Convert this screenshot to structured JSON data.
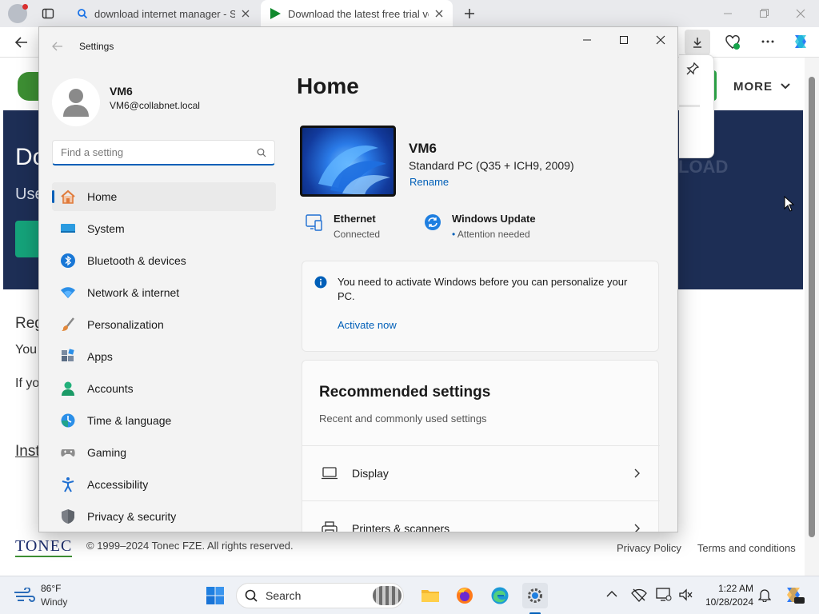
{
  "browser": {
    "tabs": [
      {
        "label": "download internet manager - Sea"
      },
      {
        "label": "Download the latest free trial vers"
      }
    ]
  },
  "webpage": {
    "hero_heading": "Do",
    "hero_sub": "Use",
    "hero_right": "LOAD",
    "more_label": "MORE",
    "reg_heading": "Reg",
    "reg_line1": "You",
    "reg_line2": "If yo",
    "inst_heading": "Inst",
    "logo": "TONEC",
    "copyright": "© 1999–2024 Tonec FZE. All rights reserved.",
    "footer_links": [
      "Privacy Policy",
      "Terms and conditions"
    ]
  },
  "settings": {
    "window_title": "Settings",
    "user": {
      "name": "VM6",
      "email": "VM6@collabnet.local"
    },
    "search_placeholder": "Find a setting",
    "nav": [
      {
        "label": "Home",
        "icon": "home-icon",
        "active": true
      },
      {
        "label": "System",
        "icon": "system-icon"
      },
      {
        "label": "Bluetooth & devices",
        "icon": "bluetooth-icon"
      },
      {
        "label": "Network & internet",
        "icon": "network-icon"
      },
      {
        "label": "Personalization",
        "icon": "brush-icon"
      },
      {
        "label": "Apps",
        "icon": "apps-icon"
      },
      {
        "label": "Accounts",
        "icon": "accounts-icon"
      },
      {
        "label": "Time & language",
        "icon": "time-language-icon"
      },
      {
        "label": "Gaming",
        "icon": "gaming-icon"
      },
      {
        "label": "Accessibility",
        "icon": "accessibility-icon"
      },
      {
        "label": "Privacy & security",
        "icon": "shield-icon"
      }
    ],
    "page_title": "Home",
    "device": {
      "name": "VM6",
      "model": "Standard PC (Q35 + ICH9, 2009)",
      "rename": "Rename"
    },
    "ethernet": {
      "label": "Ethernet",
      "status": "Connected"
    },
    "update": {
      "label": "Windows Update",
      "status": "Attention needed"
    },
    "activation": {
      "message": "You need to activate Windows before you can personalize your PC.",
      "link": "Activate now"
    },
    "recommended": {
      "title": "Recommended settings",
      "subtitle": "Recent and commonly used settings",
      "items": [
        {
          "label": "Display"
        },
        {
          "label": "Printers & scanners"
        }
      ]
    }
  },
  "taskbar": {
    "weather_temp": "86°F",
    "weather_desc": "Windy",
    "search_label": "Search",
    "time": "1:22 AM",
    "date": "10/28/2024"
  },
  "colors": {
    "accent": "#005fb8",
    "hero_bg": "#1d2e55",
    "hero_button": "#15a37a"
  }
}
